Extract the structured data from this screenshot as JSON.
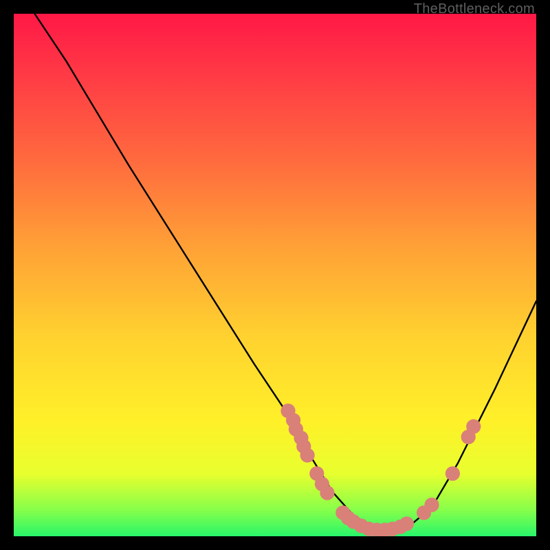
{
  "watermark": "TheBottleneck.com",
  "chart_data": {
    "type": "line",
    "title": "",
    "xlabel": "",
    "ylabel": "",
    "xlim": [
      0,
      100
    ],
    "ylim": [
      0,
      100
    ],
    "gradient_stops": [
      {
        "pct": 0,
        "color": "#ff1846"
      },
      {
        "pct": 12,
        "color": "#ff3b45"
      },
      {
        "pct": 28,
        "color": "#ff6a3e"
      },
      {
        "pct": 45,
        "color": "#ffa236"
      },
      {
        "pct": 62,
        "color": "#ffd22f"
      },
      {
        "pct": 78,
        "color": "#fff029"
      },
      {
        "pct": 88,
        "color": "#e8ff2e"
      },
      {
        "pct": 95,
        "color": "#86ff4a"
      },
      {
        "pct": 100,
        "color": "#28f56b"
      }
    ],
    "series": [
      {
        "name": "bottleneck-curve",
        "path": [
          {
            "x": 4.0,
            "y": 100.0
          },
          {
            "x": 10.0,
            "y": 91.0
          },
          {
            "x": 22.0,
            "y": 71.0
          },
          {
            "x": 34.0,
            "y": 52.0
          },
          {
            "x": 46.0,
            "y": 33.0
          },
          {
            "x": 52.0,
            "y": 24.0
          },
          {
            "x": 57.0,
            "y": 15.0
          },
          {
            "x": 61.0,
            "y": 8.5
          },
          {
            "x": 65.0,
            "y": 4.0
          },
          {
            "x": 69.0,
            "y": 1.6
          },
          {
            "x": 73.0,
            "y": 1.2
          },
          {
            "x": 76.0,
            "y": 2.2
          },
          {
            "x": 80.0,
            "y": 5.5
          },
          {
            "x": 85.0,
            "y": 14.0
          },
          {
            "x": 92.0,
            "y": 28.0
          },
          {
            "x": 100.0,
            "y": 45.0
          }
        ]
      }
    ],
    "markers": {
      "name": "salmon-dots",
      "color": "#d98079",
      "radius": 1.4,
      "points": [
        {
          "x": 52.5,
          "y": 24.0
        },
        {
          "x": 53.5,
          "y": 22.2
        },
        {
          "x": 54.0,
          "y": 20.5
        },
        {
          "x": 55.0,
          "y": 18.8
        },
        {
          "x": 55.5,
          "y": 17.2
        },
        {
          "x": 56.2,
          "y": 15.5
        },
        {
          "x": 58.0,
          "y": 12.0
        },
        {
          "x": 59.0,
          "y": 10.0
        },
        {
          "x": 60.0,
          "y": 8.3
        },
        {
          "x": 63.0,
          "y": 4.5
        },
        {
          "x": 64.0,
          "y": 3.5
        },
        {
          "x": 65.0,
          "y": 2.8
        },
        {
          "x": 66.5,
          "y": 2.0
        },
        {
          "x": 68.0,
          "y": 1.4
        },
        {
          "x": 69.5,
          "y": 1.2
        },
        {
          "x": 71.0,
          "y": 1.2
        },
        {
          "x": 72.5,
          "y": 1.4
        },
        {
          "x": 74.0,
          "y": 1.8
        },
        {
          "x": 75.2,
          "y": 2.4
        },
        {
          "x": 78.5,
          "y": 4.5
        },
        {
          "x": 80.0,
          "y": 6.0
        },
        {
          "x": 84.0,
          "y": 12.0
        },
        {
          "x": 87.0,
          "y": 19.0
        },
        {
          "x": 88.0,
          "y": 21.0
        }
      ]
    }
  }
}
